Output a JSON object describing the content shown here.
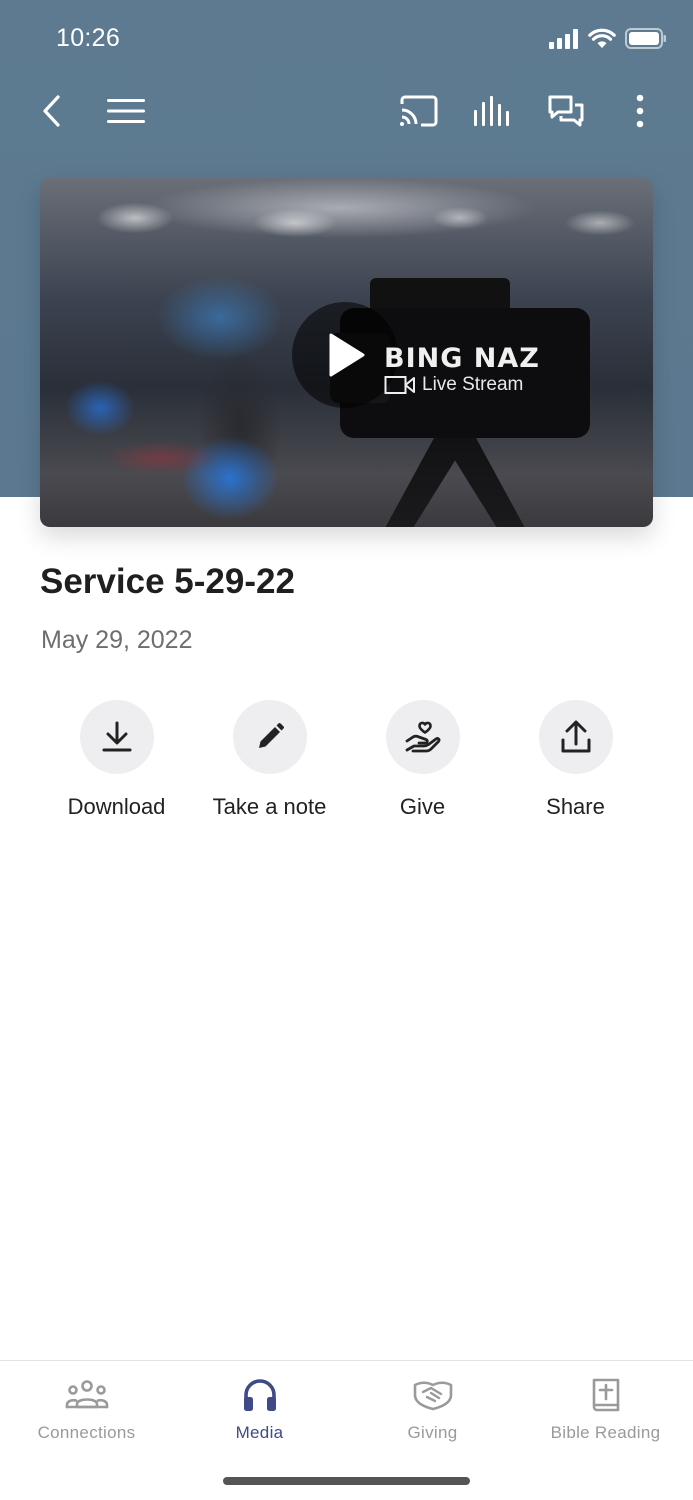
{
  "status_bar": {
    "time": "10:26"
  },
  "toolbar": {
    "back_icon": "chevron-left-icon",
    "menu_icon": "hamburger-menu-icon",
    "cast_icon": "cast-icon",
    "audio_icon": "audio-bars-icon",
    "chat_icon": "chat-bubbles-icon",
    "more_icon": "more-vertical-icon"
  },
  "hero": {
    "brand_title": "BING NAZ",
    "brand_subtitle": "Live Stream",
    "play_icon": "play-icon"
  },
  "media": {
    "title": "Service 5-29-22",
    "date": "May 29, 2022"
  },
  "actions": [
    {
      "label": "Download",
      "icon": "download-icon"
    },
    {
      "label": "Take a note",
      "icon": "pencil-icon"
    },
    {
      "label": "Give",
      "icon": "heart-hand-icon"
    },
    {
      "label": "Share",
      "icon": "share-icon"
    }
  ],
  "tabs": [
    {
      "label": "Connections",
      "icon": "people-icon",
      "active": false
    },
    {
      "label": "Media",
      "icon": "headphones-icon",
      "active": true
    },
    {
      "label": "Giving",
      "icon": "handshake-icon",
      "active": false
    },
    {
      "label": "Bible Reading",
      "icon": "bible-icon",
      "active": false
    }
  ],
  "colors": {
    "header_bg": "#5b7890",
    "accent": "#3f4a86",
    "tab_inactive": "#9a9a9a",
    "action_circle": "#eeeef0"
  }
}
